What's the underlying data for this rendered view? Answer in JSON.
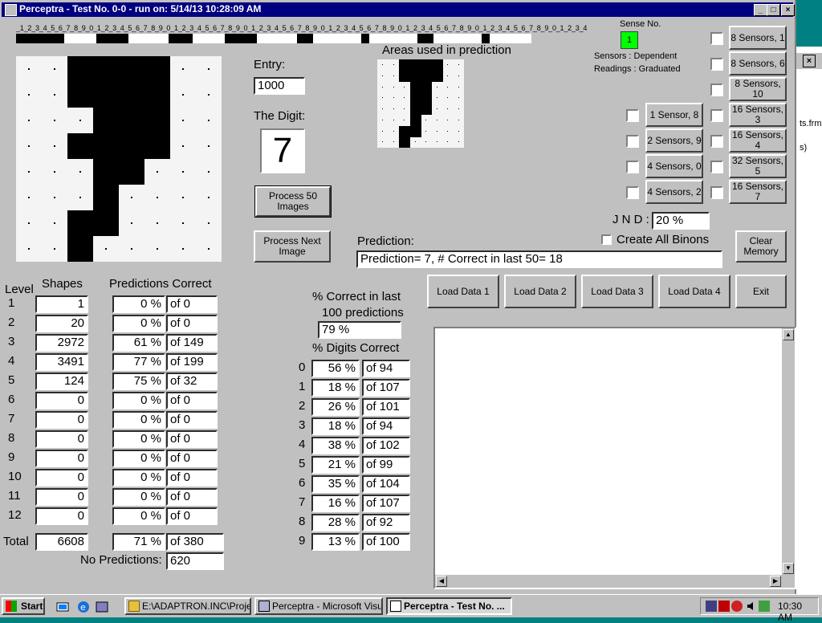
{
  "window": {
    "title": "Perceptra - Test No. 0-0 - run on: 5/14/13  10:28:09 AM"
  },
  "ruler": {
    "digits": "_1_2_3_4_5_6_7_8_9_0_1_2_3_4_5_6_7_8_9_0_1_2_3_4_5_6_7_8_9_0_1_2_3_4_5_6_7_8_9_0_1_2_3_4_5_6_7_8_9_0_1_2_3_4_5_6_7_8_9_0_1_2_3_4_5_6_7_8_9_0_1_2_3_4"
  },
  "entry": {
    "label": "Entry:",
    "value": "1000"
  },
  "digit": {
    "label": "The Digit:",
    "value": "7"
  },
  "areas_label": "Areas used in prediction",
  "sense": {
    "label": "Sense No.",
    "value": "1",
    "sensors_line": "Sensors  :  Dependent",
    "readings_line": "Readings : Graduated",
    "indicator_color": "#00ff00"
  },
  "buttons": {
    "process50": "Process 50 Images",
    "process_next": "Process Next Image",
    "clear_memory": "Clear Memory",
    "load1": "Load Data 1",
    "load2": "Load Data 2",
    "load3": "Load Data 3",
    "load4": "Load Data 4",
    "exit": "Exit"
  },
  "sensor_buttons_right": [
    "8 Sensors, 1",
    "8 Sensors, 6",
    "8 Sensors, 10",
    "16 Sensors, 3",
    "16 Sensors, 4",
    "32 Sensors, 5",
    "16 Sensors, 7"
  ],
  "sensor_buttons_left": [
    "1 Sensor, 8",
    "2 Sensors, 9",
    "4 Sensors, 0",
    "4 Sensors, 2"
  ],
  "jnd": {
    "label": "J N D :",
    "value": "20 %"
  },
  "create_binons": "Create All Binons",
  "prediction": {
    "label": "Prediction:",
    "value": "Prediction= 7, # Correct in last 50= 18"
  },
  "levels": {
    "level_header": "Level",
    "shapes_header": "Shapes",
    "predictions_header": "Predictions Correct",
    "rows": [
      {
        "level": "1",
        "shapes": "1",
        "pct": "0 %",
        "of": "of 0"
      },
      {
        "level": "2",
        "shapes": "20",
        "pct": "0 %",
        "of": "of 0"
      },
      {
        "level": "3",
        "shapes": "2972",
        "pct": "61 %",
        "of": "of 149"
      },
      {
        "level": "4",
        "shapes": "3491",
        "pct": "77 %",
        "of": "of 199"
      },
      {
        "level": "5",
        "shapes": "124",
        "pct": "75 %",
        "of": "of 32"
      },
      {
        "level": "6",
        "shapes": "0",
        "pct": "0 %",
        "of": "of 0"
      },
      {
        "level": "7",
        "shapes": "0",
        "pct": "0 %",
        "of": "of 0"
      },
      {
        "level": "8",
        "shapes": "0",
        "pct": "0 %",
        "of": "of 0"
      },
      {
        "level": "9",
        "shapes": "0",
        "pct": "0 %",
        "of": "of 0"
      },
      {
        "level": "10",
        "shapes": "0",
        "pct": "0 %",
        "of": "of 0"
      },
      {
        "level": "11",
        "shapes": "0",
        "pct": "0 %",
        "of": "of 0"
      },
      {
        "level": "12",
        "shapes": "0",
        "pct": "0 %",
        "of": "of 0"
      }
    ],
    "total_label": "Total",
    "total_shapes": "6608",
    "total_pct": "71 %",
    "total_of": "of 380",
    "no_pred_label": "No Predictions:",
    "no_pred_value": "620"
  },
  "last100": {
    "label1": "% Correct in last",
    "label2": "100 predictions",
    "value": "79 %"
  },
  "digits_correct": {
    "label": "% Digits Correct",
    "rows": [
      {
        "digit": "0",
        "pct": "56 %",
        "of": "of 94"
      },
      {
        "digit": "1",
        "pct": "18 %",
        "of": "of 107"
      },
      {
        "digit": "2",
        "pct": "26 %",
        "of": "of 101"
      },
      {
        "digit": "3",
        "pct": "18 %",
        "of": "of 94"
      },
      {
        "digit": "4",
        "pct": "38 %",
        "of": "of 102"
      },
      {
        "digit": "5",
        "pct": "21 %",
        "of": "of 99"
      },
      {
        "digit": "6",
        "pct": "35 %",
        "of": "of 104"
      },
      {
        "digit": "7",
        "pct": "16 %",
        "of": "of 107"
      },
      {
        "digit": "8",
        "pct": "28 %",
        "of": "of 92"
      },
      {
        "digit": "9",
        "pct": "13 %",
        "of": "of 100"
      }
    ]
  },
  "background_window": {
    "text1": "ts.frm",
    "text2": "s)"
  },
  "taskbar": {
    "start": "Start",
    "items": [
      "E:\\ADAPTRON.INC\\Proje...",
      "Perceptra - Microsoft Visua...",
      "Perceptra - Test No. ..."
    ],
    "clock": "10:30 AM"
  }
}
